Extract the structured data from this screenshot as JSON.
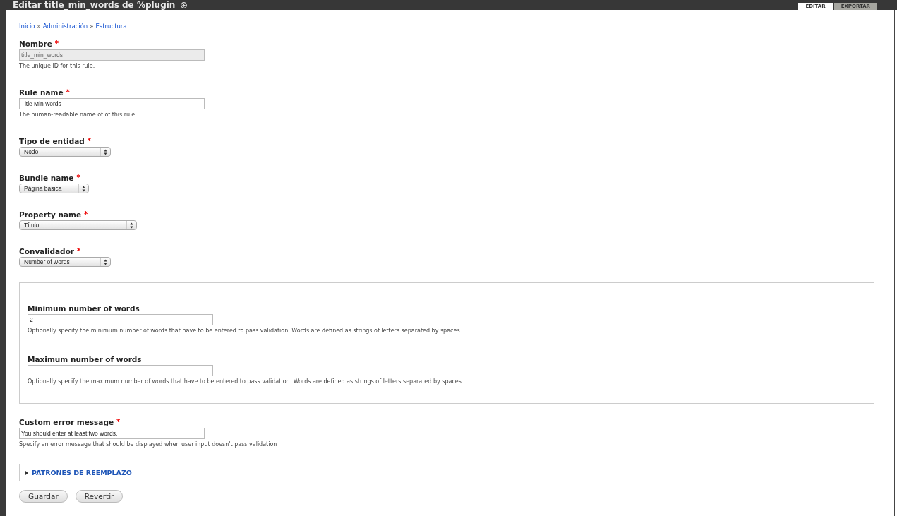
{
  "header": {
    "title": "Editar title_min_words de %plugin",
    "tabs": [
      {
        "label": "EDITAR",
        "selected": true
      },
      {
        "label": "EXPORTAR",
        "selected": false
      }
    ]
  },
  "breadcrumb": [
    "Inicio",
    "Administración",
    "Estructura"
  ],
  "breadcrumb_separator": "»",
  "fields": [
    {
      "kind": "text",
      "label": "Nombre",
      "required": true,
      "value": "title_min_words",
      "disabled": true,
      "description": "The unique ID for this rule."
    },
    {
      "kind": "text",
      "label": "Rule name",
      "required": true,
      "value": "Title Min words",
      "disabled": false,
      "description": "The human-readable name of of this rule."
    },
    {
      "kind": "select",
      "label": "Tipo de entidad",
      "required": true,
      "value": "Nodo"
    },
    {
      "kind": "select",
      "label": "Bundle name",
      "required": true,
      "value": "Página básica"
    },
    {
      "kind": "select",
      "label": "Property name",
      "required": true,
      "value": "Título"
    },
    {
      "kind": "select",
      "label": "Convalidador",
      "required": true,
      "value": "Number of words"
    },
    {
      "kind": "fieldset",
      "children": [
        {
          "kind": "text",
          "label": "Minimum number of words",
          "required": false,
          "value": "2",
          "disabled": false,
          "description": "Optionally specify the minimum number of words that have to be entered to pass validation. Words are defined as strings of letters separated by spaces."
        },
        {
          "kind": "text",
          "label": "Maximum number of words",
          "required": false,
          "disabled": false,
          "description": "Optionally specify the maximum number of words that have to be entered to pass validation. Words are defined as strings of letters separated by spaces."
        }
      ]
    },
    {
      "kind": "text",
      "label": "Custom error message",
      "required": true,
      "value": "You should enter at least two words.",
      "disabled": false,
      "description": "Specify an error message that should be displayed when user input doesn't pass validation"
    }
  ],
  "required_mark": "*",
  "collapsible": {
    "title": "PATRONES DE REEMPLAZO",
    "expanded": false
  },
  "buttons": [
    "Guardar",
    "Revertir"
  ]
}
